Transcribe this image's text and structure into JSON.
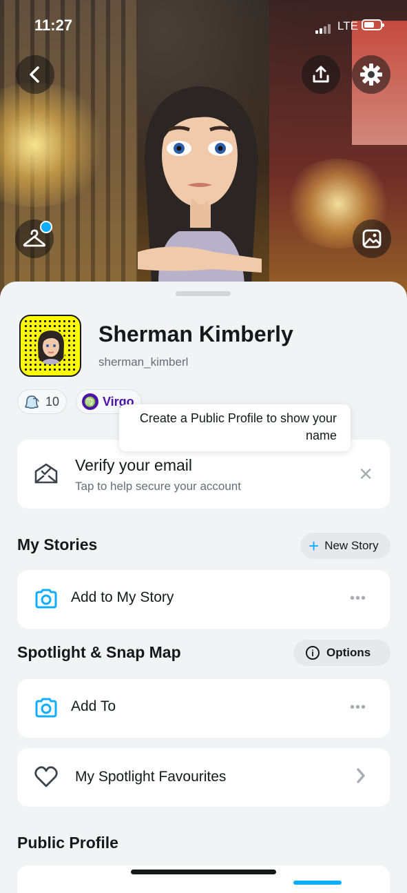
{
  "status_bar": {
    "time": "11:27",
    "network": "LTE"
  },
  "profile": {
    "display_name": "Sherman Kimberly",
    "username": "sherman_kimberl",
    "friends_count": "10",
    "zodiac": "Virgo"
  },
  "verify_card": {
    "title": "Verify your email",
    "subtitle": "Tap to help secure your account"
  },
  "my_stories": {
    "title": "My Stories",
    "new_story_label": "New Story",
    "add_label": "Add to My Story"
  },
  "spotlight": {
    "title": "Spotlight & Snap Map",
    "options_label": "Options",
    "add_label": "Add To",
    "favourites_label": "My Spotlight Favourites",
    "tooltip_line1": "Create a Public Profile to show your",
    "tooltip_line2": "name"
  },
  "public_profile": {
    "title": "Public Profile"
  },
  "colors": {
    "accent": "#0fadff",
    "snap_yellow": "#fffc00",
    "zodiac_purple": "#4b12a8"
  },
  "icons": [
    "back-icon",
    "share-icon",
    "gear-icon",
    "hanger-icon",
    "gallery-icon",
    "envelope-check-icon",
    "close-icon",
    "plus-icon",
    "camera-icon",
    "more-icon",
    "info-icon",
    "heart-icon",
    "chevron-right-icon",
    "ghost-icon"
  ]
}
